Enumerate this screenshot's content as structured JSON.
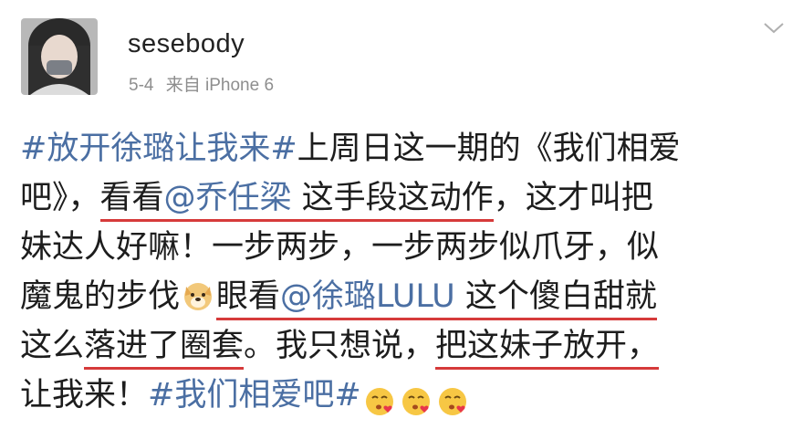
{
  "post": {
    "username": "sesebody",
    "date": "5-4",
    "source": "来自 iPhone 6"
  },
  "icons": {
    "avatar": "avatar",
    "more": "chevron-down-icon",
    "dog_emoji": "dog-face-emoji-icon",
    "kiss_emoji": "kissing-heart-emoji-icon"
  },
  "text": {
    "l1_hashtag": "#放开徐璐让我来#",
    "l1_rest": "上周日这一期的《我们相爱",
    "l2_a": "吧》，",
    "l2_b": "看看",
    "l2_mention": "@乔任梁",
    "l2_c": " 这手段这动作",
    "l2_d": "，这才叫把",
    "l3": "妹达人好嘛！一步两步，一步两步似爪牙，似",
    "l4_a": "魔鬼的步伐",
    "l4_b": "眼看",
    "l4_mention": "@徐璐LULU",
    "l4_c": " 这个傻白甜就",
    "l5_a": "这么",
    "l5_b": "落进了圈套",
    "l5_c": "。我只想说，",
    "l5_d": "把这妹子放开，",
    "l6_a": "让我来！",
    "l6_hashtag": "#我们相爱吧#"
  },
  "colors": {
    "link": "#4b6fa3",
    "underline": "#d63a3a",
    "text": "#1d1d1d",
    "meta": "#8e8e8e"
  }
}
